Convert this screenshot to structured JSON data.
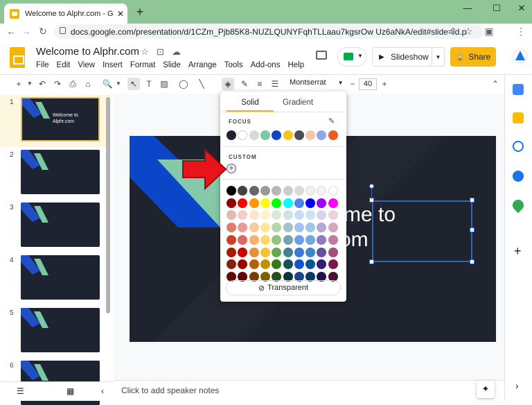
{
  "browser": {
    "tab_title": "Welcome to Alphr.com - Google",
    "tab_close": "✕",
    "new_tab": "+",
    "url": "docs.google.com/presentation/d/1CZm_Pjb85K8-NUZLQUNYFqhTLLaau7kgsrOw Uz6aNkA/edit#slide=id.p",
    "win_min": "—",
    "win_max": "☐",
    "win_close": "✕"
  },
  "doc": {
    "title": "Welcome to Alphr.com",
    "menu": [
      "File",
      "Edit",
      "View",
      "Insert",
      "Format",
      "Slide",
      "Arrange",
      "Tools",
      "Add-ons",
      "Help"
    ],
    "slideshow_label": "Slideshow",
    "share_label": "Share"
  },
  "toolbar": {
    "font": "Montserrat",
    "font_size": "40"
  },
  "slides": [
    {
      "num": "1",
      "title": "Welcome to Alphr.com"
    },
    {
      "num": "2",
      "title": ""
    },
    {
      "num": "3",
      "title": ""
    },
    {
      "num": "4",
      "title": ""
    },
    {
      "num": "5",
      "title": ""
    },
    {
      "num": "6",
      "title": ""
    }
  ],
  "canvas": {
    "title_line1": "me to",
    "title_line2": "om",
    "notes_placeholder": "Click to add speaker notes"
  },
  "color_picker": {
    "tab_solid": "Solid",
    "tab_gradient": "Gradient",
    "focus_label": "FOCUS",
    "custom_label": "CUSTOM",
    "transparent_label": "Transparent",
    "focus_colors": [
      "#1f232e",
      "#ffffff",
      "#d9d9d9",
      "#7bc8a3",
      "#0b46c8",
      "#f5c518",
      "#4a4e5a",
      "#f3c7a8",
      "#8fa7e8",
      "#f05a1a"
    ],
    "grid": [
      [
        "#000000",
        "#434343",
        "#666666",
        "#999999",
        "#b7b7b7",
        "#cccccc",
        "#d9d9d9",
        "#efefef",
        "#f3f3f3",
        "#ffffff"
      ],
      [
        "#980000",
        "#ff0000",
        "#ff9900",
        "#ffff00",
        "#00ff00",
        "#00ffff",
        "#4a86e8",
        "#0000ff",
        "#9900ff",
        "#ff00ff"
      ],
      [
        "#e6b8af",
        "#f4cccc",
        "#fce5cd",
        "#fff2cc",
        "#d9ead3",
        "#d0e0e3",
        "#c9daf8",
        "#cfe2f3",
        "#d9d2e9",
        "#ead1dc"
      ],
      [
        "#dd7e6b",
        "#ea9999",
        "#f9cb9c",
        "#ffe599",
        "#b6d7a8",
        "#a2c4c9",
        "#a4c2f4",
        "#9fc5e8",
        "#b4a7d6",
        "#d5a6bd"
      ],
      [
        "#cc4125",
        "#e06666",
        "#f6b26b",
        "#ffd966",
        "#93c47d",
        "#76a5af",
        "#6d9eeb",
        "#6fa8dc",
        "#8e7cc3",
        "#c27ba0"
      ],
      [
        "#a61c00",
        "#cc0000",
        "#e69138",
        "#f1c232",
        "#6aa84f",
        "#45818e",
        "#3c78d8",
        "#3d85c6",
        "#674ea7",
        "#a64d79"
      ],
      [
        "#85200c",
        "#990000",
        "#b45f06",
        "#bf9000",
        "#38761d",
        "#134f5c",
        "#1155cc",
        "#0b5394",
        "#351c75",
        "#741b47"
      ],
      [
        "#5b0f00",
        "#660000",
        "#783f04",
        "#7f6000",
        "#274e13",
        "#0c343d",
        "#1c4587",
        "#073763",
        "#20124d",
        "#4c1130"
      ]
    ]
  },
  "colors": {
    "accent": "#f7b815",
    "selection": "#2f64c4",
    "arrow": "#e8141b"
  }
}
